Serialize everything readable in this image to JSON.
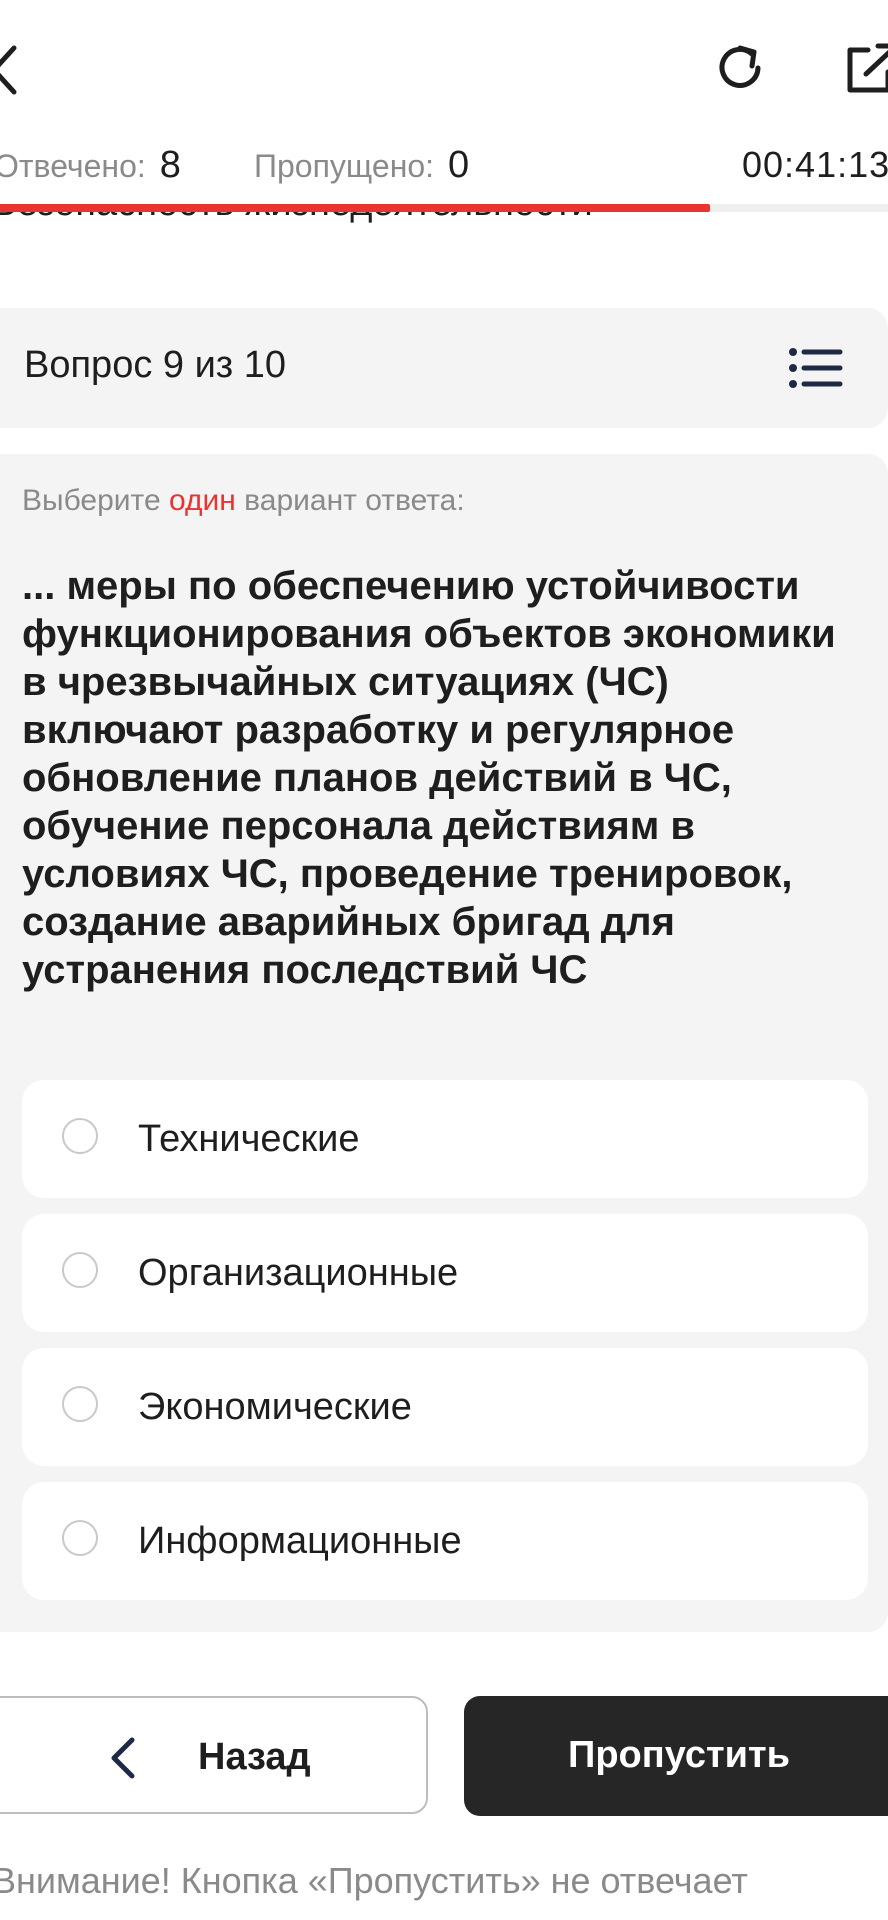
{
  "stats": {
    "answered_label": "Отвечено:",
    "answered_value": "8",
    "skipped_label": "Пропущено:",
    "skipped_value": "0",
    "timer": "00:41:13"
  },
  "progress": {
    "fraction": 0.8,
    "color": "#e9342f"
  },
  "subject": {
    "title": "Безопасность жизнедеятельности"
  },
  "question": {
    "counter": "Вопрос 9 из 10",
    "instruction_before": "Выберите ",
    "instruction_accent": "один",
    "instruction_after": " вариант ответа:",
    "text": "... меры по обеспечению устойчивости функционирования объектов экономики в чрезвычайных ситуациях (ЧС) включают разработку и регулярное обновление планов действий в ЧС, обучение персонала действиям в условиях ЧС, проведение тренировок, создание аварийных бригад для устранения последствий ЧС"
  },
  "options": [
    {
      "label": "Технические"
    },
    {
      "label": "Организационные"
    },
    {
      "label": "Экономические"
    },
    {
      "label": "Информационные"
    }
  ],
  "buttons": {
    "back_label": "Назад",
    "skip_label": "Пропустить"
  },
  "warning": {
    "text": "Внимание! Кнопка «Пропустить» не отвечает"
  },
  "icons": {
    "back": "chevron-left-icon",
    "refresh": "refresh-icon",
    "share": "external-link-icon",
    "list": "list-icon"
  },
  "colors": {
    "accent": "#e9342f",
    "card_bg": "#f4f4f4",
    "dark_button": "#262626"
  }
}
